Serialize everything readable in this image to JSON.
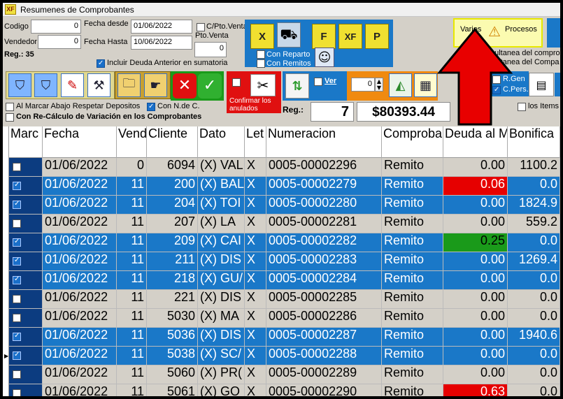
{
  "window": {
    "title": "Resumenes de Comprobantes",
    "icon_text": "XF"
  },
  "filters": {
    "codigo_label": "Codigo",
    "codigo_value": "0",
    "vendedor_label": "Vendedor",
    "vendedor_value": "0",
    "fecha_desde_label": "Fecha desde",
    "fecha_desde_value": "01/06/2022",
    "fecha_hasta_label": "Fecha Hasta",
    "fecha_hasta_value": "10/06/2022",
    "cpto_label": "C/Pto.Venta",
    "ptoventa_label": "Pto.Venta",
    "ptoventa_value": "0",
    "reg_label": "Reg.: 35",
    "incluir_deuda_label": "Incluir Deuda Anterior en sumatoria"
  },
  "toolbar": {
    "x_label": "X",
    "f_label": "F",
    "xf_label": "XF",
    "p_label": "P",
    "con_reparto_label": "Con Reparto",
    "con_remitos_label": "Con Remitos",
    "varios_label": "Varios",
    "procesos_label": "Procesos",
    "simultanea_1": "simultanea del compro",
    "simultanea_2": "simultanea del Compa",
    "confirmar_label": "Confirmar los anulados",
    "ver_label": "Ver",
    "spin_value": "0",
    "rgen_label": "R.Gen",
    "cpers_label": "C.Pers.",
    "los_items_label": "los Items"
  },
  "options": {
    "al_marcar_label": "Al Marcar Abajo Respetar Depositos",
    "con_nde_label": "Con N.de C.",
    "recalculo_label": "Con Re-Cálculo de Variación en los Comprobantes"
  },
  "summary": {
    "reg_label": "Reg.:",
    "reg_count": "7",
    "total": "$80393.44"
  },
  "colors": {
    "accent": "#1a78c8",
    "highlight_red": "#e60000",
    "highlight_green": "#1a9a1a",
    "arrow": "#e80000"
  },
  "grid": {
    "headers": [
      "Marc",
      "Fecha",
      "Vend",
      "Cliente",
      "Dato",
      "Let",
      "Numeracion",
      "Comproba",
      "Deuda al M",
      "Bonifica"
    ],
    "rows": [
      {
        "marked": false,
        "selected": false,
        "fecha": "01/06/2022",
        "vend": "0",
        "cliente": "6094",
        "dato": "(X) VAL",
        "let": "X",
        "numeracion": "0005-00002296",
        "comprob": "Remito",
        "deuda": "0.00",
        "deuda_style": "",
        "bonifica": "1100.2"
      },
      {
        "marked": true,
        "selected": true,
        "fecha": "01/06/2022",
        "vend": "11",
        "cliente": "200",
        "dato": "(X) BAL",
        "let": "X",
        "numeracion": "0005-00002279",
        "comprob": "Remito",
        "deuda": "0.06",
        "deuda_style": "red",
        "bonifica": "0.0"
      },
      {
        "marked": true,
        "selected": true,
        "fecha": "01/06/2022",
        "vend": "11",
        "cliente": "204",
        "dato": "(X) TOI",
        "let": "X",
        "numeracion": "0005-00002280",
        "comprob": "Remito",
        "deuda": "0.00",
        "deuda_style": "",
        "bonifica": "1824.9"
      },
      {
        "marked": false,
        "selected": false,
        "fecha": "01/06/2022",
        "vend": "11",
        "cliente": "207",
        "dato": "(X) LA",
        "let": "X",
        "numeracion": "0005-00002281",
        "comprob": "Remito",
        "deuda": "0.00",
        "deuda_style": "",
        "bonifica": "559.2"
      },
      {
        "marked": true,
        "selected": true,
        "fecha": "01/06/2022",
        "vend": "11",
        "cliente": "209",
        "dato": "(X) CAI",
        "let": "X",
        "numeracion": "0005-00002282",
        "comprob": "Remito",
        "deuda": "0.25",
        "deuda_style": "green",
        "bonifica": "0.0"
      },
      {
        "marked": true,
        "selected": true,
        "fecha": "01/06/2022",
        "vend": "11",
        "cliente": "211",
        "dato": "(X) DIS",
        "let": "X",
        "numeracion": "0005-00002283",
        "comprob": "Remito",
        "deuda": "0.00",
        "deuda_style": "",
        "bonifica": "1269.4"
      },
      {
        "marked": true,
        "selected": true,
        "fecha": "01/06/2022",
        "vend": "11",
        "cliente": "218",
        "dato": "(X) GU/",
        "let": "X",
        "numeracion": "0005-00002284",
        "comprob": "Remito",
        "deuda": "0.00",
        "deuda_style": "",
        "bonifica": "0.0"
      },
      {
        "marked": false,
        "selected": false,
        "fecha": "01/06/2022",
        "vend": "11",
        "cliente": "221",
        "dato": "(X) DIS",
        "let": "X",
        "numeracion": "0005-00002285",
        "comprob": "Remito",
        "deuda": "0.00",
        "deuda_style": "",
        "bonifica": "0.0"
      },
      {
        "marked": false,
        "selected": false,
        "fecha": "01/06/2022",
        "vend": "11",
        "cliente": "5030",
        "dato": "(X) MA",
        "let": "X",
        "numeracion": "0005-00002286",
        "comprob": "Remito",
        "deuda": "0.00",
        "deuda_style": "",
        "bonifica": "0.0"
      },
      {
        "marked": true,
        "selected": true,
        "fecha": "01/06/2022",
        "vend": "11",
        "cliente": "5036",
        "dato": "(X) DIS",
        "let": "X",
        "numeracion": "0005-00002287",
        "comprob": "Remito",
        "deuda": "0.00",
        "deuda_style": "",
        "bonifica": "1940.6"
      },
      {
        "marked": true,
        "selected": true,
        "fecha": "01/06/2022",
        "vend": "11",
        "cliente": "5038",
        "dato": "(X) SC/",
        "let": "X",
        "numeracion": "0005-00002288",
        "comprob": "Remito",
        "deuda": "0.00",
        "deuda_style": "",
        "bonifica": "0.0"
      },
      {
        "marked": false,
        "selected": false,
        "fecha": "01/06/2022",
        "vend": "11",
        "cliente": "5060",
        "dato": "(X) PR(",
        "let": "X",
        "numeracion": "0005-00002289",
        "comprob": "Remito",
        "deuda": "0.00",
        "deuda_style": "",
        "bonifica": "0.0"
      },
      {
        "marked": false,
        "selected": false,
        "fecha": "01/06/2022",
        "vend": "11",
        "cliente": "5061",
        "dato": "(X) GO",
        "let": "X",
        "numeracion": "0005-00002290",
        "comprob": "Remito",
        "deuda": "0.63",
        "deuda_style": "red",
        "bonifica": "0.0"
      }
    ]
  }
}
